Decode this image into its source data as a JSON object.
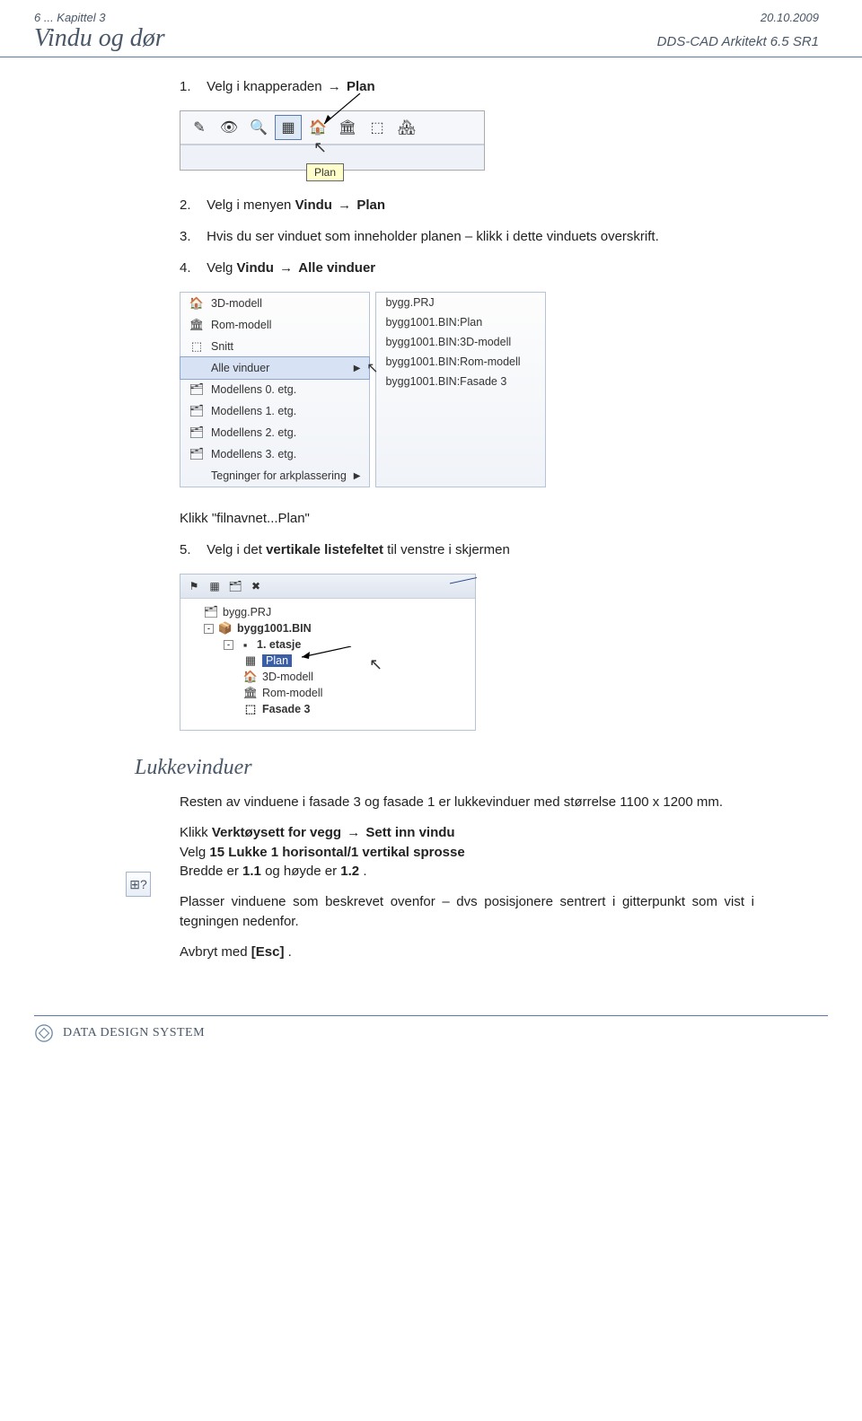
{
  "header": {
    "left": "6 ... Kapittel 3",
    "right": "20.10.2009"
  },
  "title": {
    "left": "Vindu og dør",
    "right": "DDS-CAD Arkitekt 6.5 SR1"
  },
  "steps": {
    "s1_num": "1.",
    "s1_a": "Velg i knapperaden ",
    "s1_b": "Plan",
    "s2_num": "2.",
    "s2_a": "Velg i menyen ",
    "s2_b": "Vindu ",
    "s2_c": "Plan",
    "s3_num": "3.",
    "s3_a": "Hvis du ser vinduet som inneholder planen – klikk i dette vinduets overskrift.",
    "s4_num": "4.",
    "s4_a": "Velg ",
    "s4_b": "Vindu ",
    "s4_c": "Alle vinduer",
    "klikk_label": "Klikk  \"filnavnet...Plan\"",
    "s5_num": "5.",
    "s5_a": "Velg i det ",
    "s5_b": "vertikale listefeltet",
    "s5_c": " til venstre i skjermen"
  },
  "toolbar": {
    "tooltip": "Plan",
    "icons": [
      "✎",
      "👁",
      "🔍",
      "▦",
      "🏠",
      "🏛",
      "⬚",
      "🏘"
    ]
  },
  "menu1": {
    "items": [
      {
        "label": "3D-modell",
        "icon": "🏠"
      },
      {
        "label": "Rom-modell",
        "icon": "🏛"
      },
      {
        "label": "Snitt",
        "icon": "⬚"
      },
      {
        "label": "Alle vinduer",
        "icon": "",
        "highlight": true,
        "arrow": true
      },
      {
        "label": "Modellens 0. etg.",
        "icon": "🗂"
      },
      {
        "label": "Modellens 1. etg.",
        "icon": "🗂"
      },
      {
        "label": "Modellens 2. etg.",
        "icon": "🗂"
      },
      {
        "label": "Modellens 3. etg.",
        "icon": "🗂"
      },
      {
        "label": "Tegninger for arkplassering",
        "icon": "",
        "arrow": true
      }
    ]
  },
  "menu2": {
    "items": [
      {
        "label": "bygg.PRJ"
      },
      {
        "label": "bygg1001.BIN:Plan"
      },
      {
        "label": "bygg1001.BIN:3D-modell"
      },
      {
        "label": "bygg1001.BIN:Rom-modell"
      },
      {
        "label": "bygg1001.BIN:Fasade 3"
      }
    ]
  },
  "tree": {
    "items": [
      {
        "label": "bygg.PRJ",
        "icon": "🗂",
        "indent": 1
      },
      {
        "label": "bygg1001.BIN",
        "icon": "📦",
        "indent": 1,
        "bold": true,
        "expander": "-"
      },
      {
        "label": "1. etasje",
        "icon": "▪",
        "indent": 2,
        "bold": true,
        "expander": "-"
      },
      {
        "label": "Plan",
        "icon": "▦",
        "indent": 3,
        "selected": true
      },
      {
        "label": "3D-modell",
        "icon": "🏠",
        "indent": 3
      },
      {
        "label": "Rom-modell",
        "icon": "🏛",
        "indent": 3
      },
      {
        "label": "Fasade 3",
        "icon": "⬚",
        "indent": 3,
        "bold": true
      }
    ]
  },
  "section": {
    "heading": "Lukkevinduer",
    "p1": "Resten av vinduene i fasade 3 og fasade 1 er lukkevinduer med størrelse 1100 x 1200 mm.",
    "p2a": "Klikk ",
    "p2b": "Verktøysett for vegg ",
    "p2c": "Sett inn vindu",
    "p3a": "Velg ",
    "p3b": "15 Lukke 1 horisontal/1 vertikal sprosse",
    "p4a": "Bredde er ",
    "p4b": "1.1",
    "p4c": " og høyde er ",
    "p4d": "1.2",
    "p4e": ".",
    "p5": "Plasser vinduene som beskrevet ovenfor – dvs posisjonere sentrert i gitterpunkt som vist i tegningen nedenfor.",
    "p6a": "Avbryt med ",
    "p6b": "[Esc]",
    "p6c": "."
  },
  "footer": {
    "brand_a": "D",
    "brand_b": "ATA ",
    "brand_c": "D",
    "brand_d": "ESIGN ",
    "brand_e": "S",
    "brand_f": "YSTEM"
  }
}
